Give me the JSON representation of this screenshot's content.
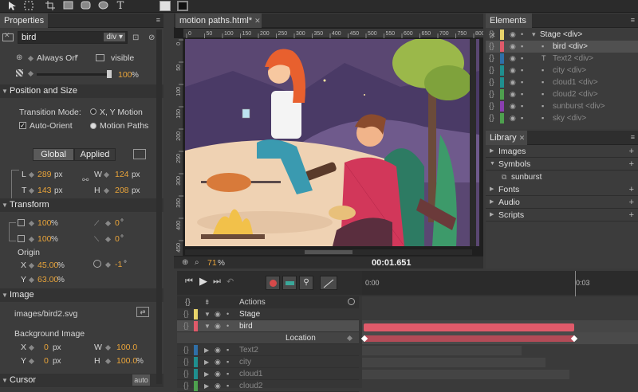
{
  "toolbar": {
    "icons": [
      "select-arrow-icon",
      "marquee-icon",
      "rectangle-icon",
      "rounded-rect-icon",
      "ellipse-icon",
      "text-tool-icon",
      "fill-swatch-icon",
      "stroke-swatch-icon"
    ],
    "text_glyph": "T"
  },
  "properties": {
    "tab": "Properties",
    "element_name": "bird",
    "element_type": "div",
    "always_on": "Always On",
    "visible": "visible",
    "opacity": "100",
    "opacity_unit": "%",
    "position_size": {
      "title": "Position and Size",
      "transition_mode_label": "Transition Mode:",
      "xy_motion": "X, Y Motion",
      "auto_orient": "Auto-Orient",
      "motion_paths": "Motion Paths",
      "global": "Global",
      "applied": "Applied",
      "L": "289",
      "T": "143",
      "W": "124",
      "H": "208",
      "unit": "px",
      "l_label": "L",
      "t_label": "T",
      "w_label": "W",
      "h_label": "H"
    },
    "transform": {
      "title": "Transform",
      "scale_x": "100",
      "scale_y": "100",
      "skew_x": "0",
      "skew_y": "0",
      "percent": "%",
      "degree": "°",
      "origin_label": "Origin",
      "origin_x": "45.00",
      "origin_y": "63.00",
      "x_label": "X",
      "y_label": "Y",
      "rotation": "-1"
    },
    "image": {
      "title": "Image",
      "path": "images/bird2.svg",
      "bg_label": "Background Image",
      "x": "0",
      "y": "0",
      "w": "100.0",
      "h": "100.0",
      "px": "px",
      "w_label": "W",
      "h_label": "H"
    },
    "cursor": {
      "title": "Cursor",
      "auto": "auto"
    }
  },
  "stage": {
    "tab": "motion paths.html*",
    "ruler_h": [
      "0",
      "50",
      "100",
      "150",
      "200",
      "250",
      "300",
      "350",
      "400",
      "450",
      "500",
      "550",
      "600",
      "650",
      "700",
      "750",
      "800"
    ],
    "ruler_v": [
      "0",
      "50",
      "100",
      "150",
      "200",
      "250",
      "300",
      "350",
      "400",
      "450"
    ],
    "zoom": "71",
    "zoom_unit": "%",
    "time": "00:01.651"
  },
  "elements": {
    "tab": "Elements",
    "rows": [
      {
        "name": "Stage <div>",
        "color": "#e8d36a",
        "indent": 0,
        "type": "stage",
        "selected": false,
        "dim": false
      },
      {
        "name": "bird <div>",
        "color": "#e05a6a",
        "indent": 1,
        "type": "div",
        "selected": true,
        "dim": false
      },
      {
        "name": "Text2 <div>",
        "color": "#2f6fa8",
        "indent": 1,
        "type": "text",
        "selected": false,
        "dim": true
      },
      {
        "name": "city <div>",
        "color": "#1f8f8f",
        "indent": 1,
        "type": "div",
        "selected": false,
        "dim": true
      },
      {
        "name": "cloud1 <div>",
        "color": "#1f8f8f",
        "indent": 1,
        "type": "div",
        "selected": false,
        "dim": true
      },
      {
        "name": "cloud2 <div>",
        "color": "#4ea04e",
        "indent": 1,
        "type": "div",
        "selected": false,
        "dim": true
      },
      {
        "name": "sunburst <div>",
        "color": "#8a3fb0",
        "indent": 1,
        "type": "div",
        "selected": false,
        "dim": true
      },
      {
        "name": "sky <div>",
        "color": "#4ea04e",
        "indent": 1,
        "type": "div",
        "selected": false,
        "dim": true
      }
    ]
  },
  "library": {
    "tab": "Library",
    "sections": [
      "Images",
      "Symbols",
      "Fonts",
      "Audio",
      "Scripts"
    ],
    "symbol_item": "sunburst"
  },
  "timeline": {
    "actions": "Actions",
    "time_start": "0:00",
    "time_end": "0:03",
    "rows": [
      {
        "name": "Stage",
        "color": "#e8d36a",
        "dim": false
      },
      {
        "name": "bird",
        "color": "#e05a6a",
        "dim": false
      },
      {
        "name": "Text2",
        "color": "#2f6fa8",
        "dim": true
      },
      {
        "name": "city",
        "color": "#1f8f8f",
        "dim": true
      },
      {
        "name": "cloud1",
        "color": "#1f8f8f",
        "dim": true
      },
      {
        "name": "cloud2",
        "color": "#4ea04e",
        "dim": true
      }
    ],
    "location": "Location"
  }
}
